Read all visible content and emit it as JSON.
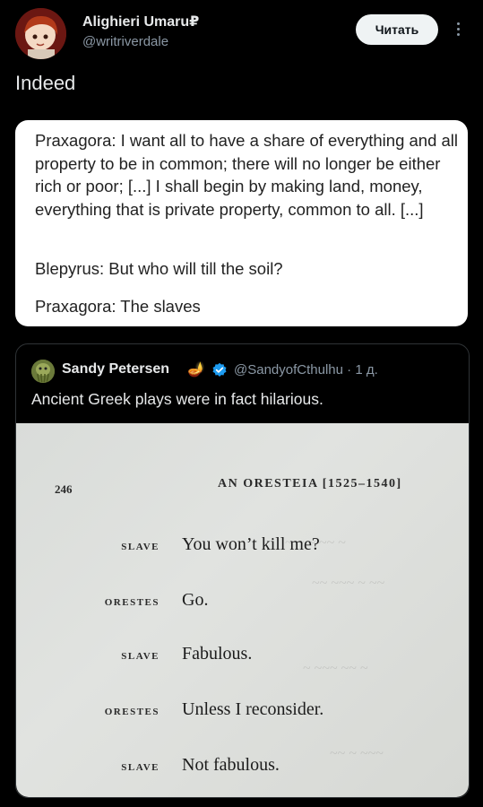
{
  "header": {
    "display_name": "Alighieri Umaru₽",
    "handle": "@writriverdale",
    "follow_label": "Читать"
  },
  "tweet": {
    "text": "Indeed"
  },
  "quote_image": {
    "lines": [
      "Praxagora: I want all to have a share of everything and all property to be in common; there will no longer be either rich or poor; [...] I shall begin by making land, money, everything that is private property, common to all. [...]",
      "Blepyrus: But who will till the soil?",
      "Praxagora: The slaves"
    ]
  },
  "embedded_tweet": {
    "display_name": "Sandy Petersen",
    "emoji": "🪔",
    "handle": "@SandyofCthulhu",
    "time": "· 1 д.",
    "text": "Ancient Greek plays were in fact hilarious.",
    "book_page": {
      "page_number": "246",
      "running_head": "AN ORESTEIA [1525–1540]",
      "dialogue": [
        {
          "speaker": "SLAVE",
          "line": "You won’t kill me?"
        },
        {
          "speaker": "ORESTES",
          "line": "Go."
        },
        {
          "speaker": "SLAVE",
          "line": "Fabulous."
        },
        {
          "speaker": "ORESTES",
          "line": "Unless I reconsider."
        },
        {
          "speaker": "SLAVE",
          "line": "Not fabulous."
        }
      ]
    }
  },
  "colors": {
    "background": "#000000",
    "text": "#e7e9ea",
    "secondary_text": "#8b98a5",
    "verified": "#1d9bf0",
    "follow_button_bg": "#eff3f4"
  }
}
